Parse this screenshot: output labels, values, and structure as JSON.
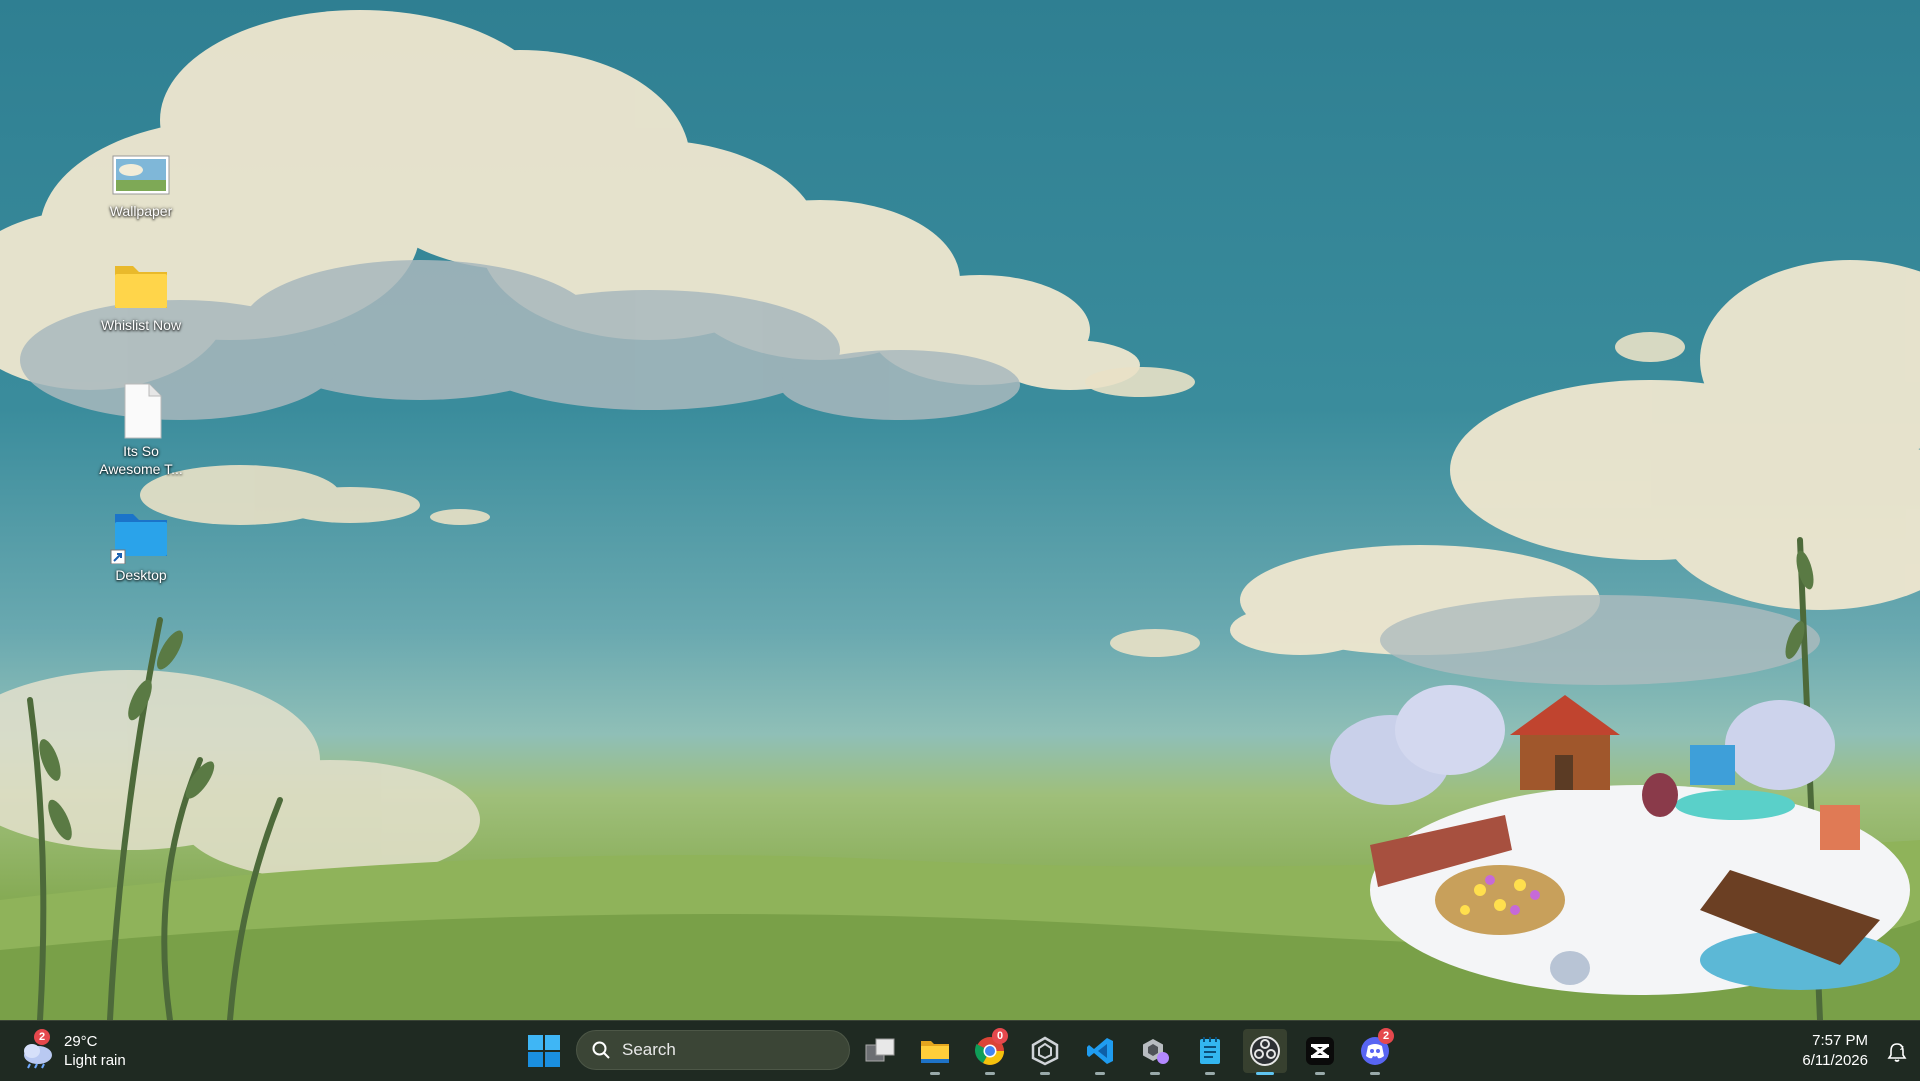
{
  "desktop": {
    "icons": [
      {
        "label": "Wallpaper",
        "icon": "image-file-icon"
      },
      {
        "label": "Whislist Now",
        "icon": "folder-icon"
      },
      {
        "label": "Its So Awesome T...",
        "icon": "text-document-icon"
      },
      {
        "label": "Desktop",
        "icon": "desktop-folder-shortcut-icon"
      }
    ]
  },
  "taskbar": {
    "weather": {
      "temperature": "29°C",
      "condition": "Light rain",
      "badge": "2",
      "icon": "rain-cloud-icon"
    },
    "search": {
      "placeholder": "Search"
    },
    "apps": [
      {
        "name": "task-view",
        "icon": "task-view-icon"
      },
      {
        "name": "file-explorer",
        "icon": "folder-icon"
      },
      {
        "name": "chrome",
        "icon": "chrome-icon",
        "badge": "0"
      },
      {
        "name": "unity",
        "icon": "unity-icon"
      },
      {
        "name": "vscode",
        "icon": "vscode-icon"
      },
      {
        "name": "unity-hub",
        "icon": "unity-hub-icon"
      },
      {
        "name": "notepad",
        "icon": "notepad-icon"
      },
      {
        "name": "obs",
        "icon": "obs-icon",
        "active": true
      },
      {
        "name": "capcut",
        "icon": "capcut-icon"
      },
      {
        "name": "discord",
        "icon": "discord-icon",
        "badge": "2"
      }
    ],
    "clock": {
      "time": "7:57 PM",
      "date": "6/11/2026"
    }
  },
  "colors": {
    "taskbar": "#1f2a22",
    "accent": "#5fc4f0",
    "badge": "#e5484d"
  }
}
